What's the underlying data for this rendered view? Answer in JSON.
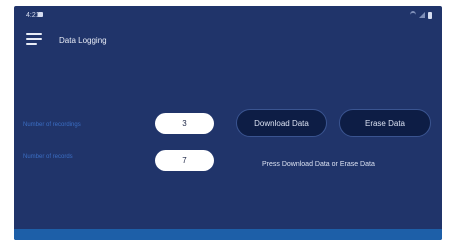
{
  "status_bar": {
    "time": "4:21",
    "icons": [
      "notification-icon",
      "wifi-icon",
      "signal-icon",
      "battery-icon"
    ]
  },
  "app_bar": {
    "menu_icon": "hamburger-menu-icon",
    "title": "Data Logging"
  },
  "fields": {
    "recordings": {
      "label": "Number of recordings",
      "value": "3"
    },
    "records": {
      "label": "Number of records",
      "value": "7"
    }
  },
  "actions": {
    "download_label": "Download Data",
    "erase_label": "Erase Data"
  },
  "hint": "Press Download Data or Erase Data",
  "colors": {
    "background": "#20346a",
    "label": "#3b6ec4",
    "button": "#0d1d45",
    "bottom_band": "#1d5fa8"
  }
}
